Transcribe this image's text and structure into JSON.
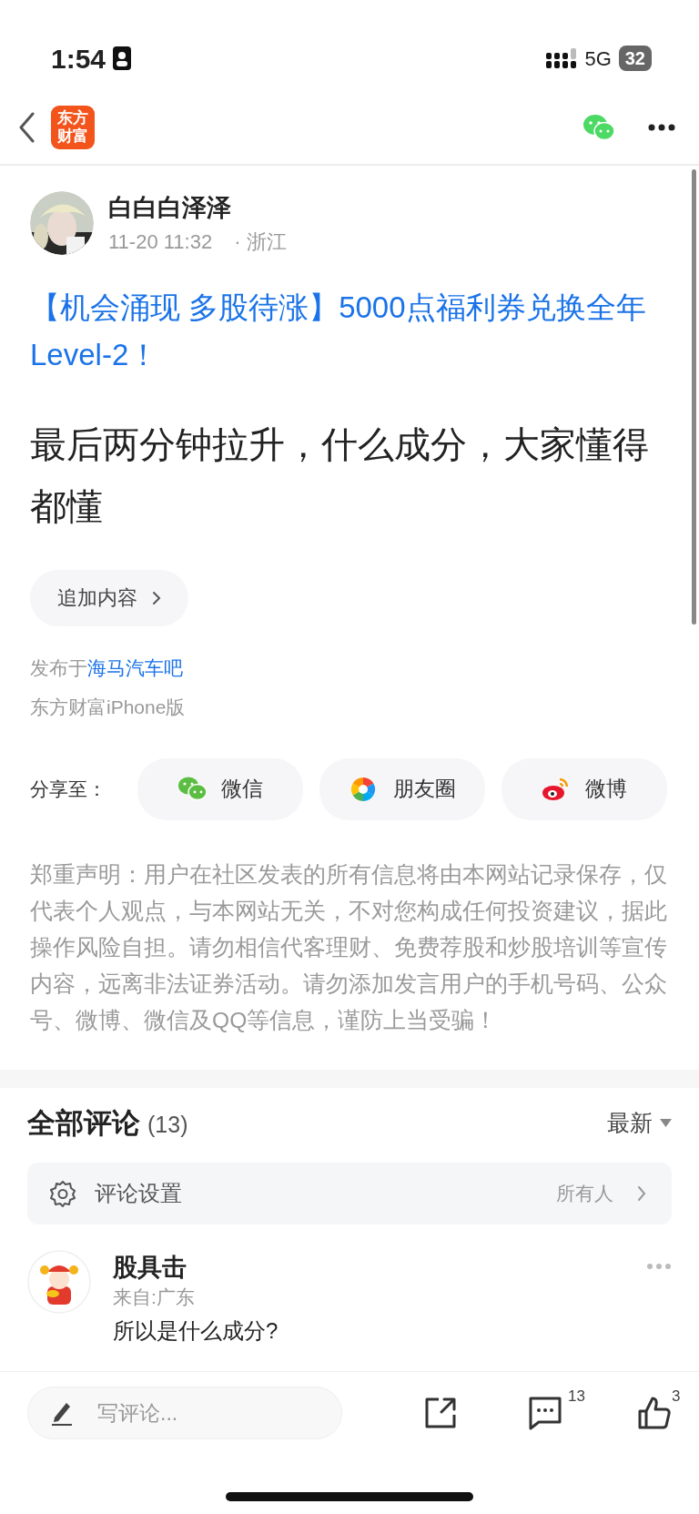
{
  "status_bar": {
    "time": "1:54",
    "network": "5G",
    "battery": "32"
  },
  "nav": {
    "logo_lines": [
      "东方",
      "财富"
    ]
  },
  "post": {
    "author": "白白白泽泽",
    "time": "11-20 11:32",
    "location": "· 浙江",
    "title": "【机会涌现 多股待涨】5000点福利券兑换全年Level-2！",
    "body": "最后两分钟拉升，什么成分，大家懂得都懂",
    "append_button": "追加内容",
    "published_prefix": "发布于",
    "forum": "海马汽车吧",
    "client": "东方财富iPhone版"
  },
  "share": {
    "label": "分享至：",
    "targets": [
      {
        "kind": "wechat",
        "label": "微信"
      },
      {
        "kind": "moments",
        "label": "朋友圈"
      },
      {
        "kind": "weibo",
        "label": "微博"
      }
    ]
  },
  "disclaimer": "郑重声明：用户在社区发表的所有信息将由本网站记录保存，仅代表个人观点，与本网站无关，不对您构成任何投资建议，据此操作风险自担。请勿相信代客理财、免费荐股和炒股培训等宣传内容，远离非法证券活动。请勿添加发言用户的手机号码、公众号、微博、微信及QQ等信息，谨防上当受骗！",
  "comments": {
    "title": "全部评论",
    "count": "(13)",
    "sort": "最新",
    "settings": {
      "label": "评论设置",
      "value": "所有人"
    },
    "items": [
      {
        "author": "股具击",
        "origin": "来自:广东",
        "text": "所以是什么成分?"
      }
    ]
  },
  "bottom_bar": {
    "placeholder": "写评论...",
    "comment_count": "13",
    "like_count": "3"
  }
}
